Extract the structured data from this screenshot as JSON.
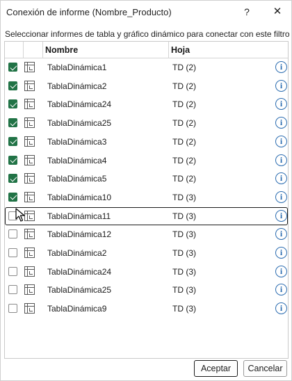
{
  "window": {
    "title": "Conexión de informe (Nombre_Producto)",
    "help_label": "?",
    "close_label": "✕"
  },
  "instruction": "Seleccionar informes de tabla y gráfico dinámico para conectar con este filtro",
  "table": {
    "columns": [
      "Nombre",
      "Hoja"
    ],
    "rows": [
      {
        "checked": true,
        "name": "TablaDinámica1",
        "sheet": "TD (2)"
      },
      {
        "checked": true,
        "name": "TablaDinámica2",
        "sheet": "TD (2)"
      },
      {
        "checked": true,
        "name": "TablaDinámica24",
        "sheet": "TD (2)"
      },
      {
        "checked": true,
        "name": "TablaDinámica25",
        "sheet": "TD (2)"
      },
      {
        "checked": true,
        "name": "TablaDinámica3",
        "sheet": "TD (2)"
      },
      {
        "checked": true,
        "name": "TablaDinámica4",
        "sheet": "TD (2)"
      },
      {
        "checked": true,
        "name": "TablaDinámica5",
        "sheet": "TD (2)"
      },
      {
        "checked": true,
        "name": "TablaDinámica10",
        "sheet": "TD (3)"
      },
      {
        "checked": false,
        "name": "TablaDinámica11",
        "sheet": "TD (3)",
        "focused": true
      },
      {
        "checked": false,
        "name": "TablaDinámica12",
        "sheet": "TD (3)"
      },
      {
        "checked": false,
        "name": "TablaDinámica2",
        "sheet": "TD (3)"
      },
      {
        "checked": false,
        "name": "TablaDinámica24",
        "sheet": "TD (3)"
      },
      {
        "checked": false,
        "name": "TablaDinámica25",
        "sheet": "TD (3)"
      },
      {
        "checked": false,
        "name": "TablaDinámica9",
        "sheet": "TD (3)"
      }
    ],
    "row_icon": "pivot-table-icon",
    "info_icon": "info-icon",
    "info_glyph": "i"
  },
  "buttons": {
    "accept": "Aceptar",
    "cancel": "Cancelar"
  },
  "colors": {
    "check_accent": "#217346",
    "info_accent": "#2b6cb0"
  }
}
